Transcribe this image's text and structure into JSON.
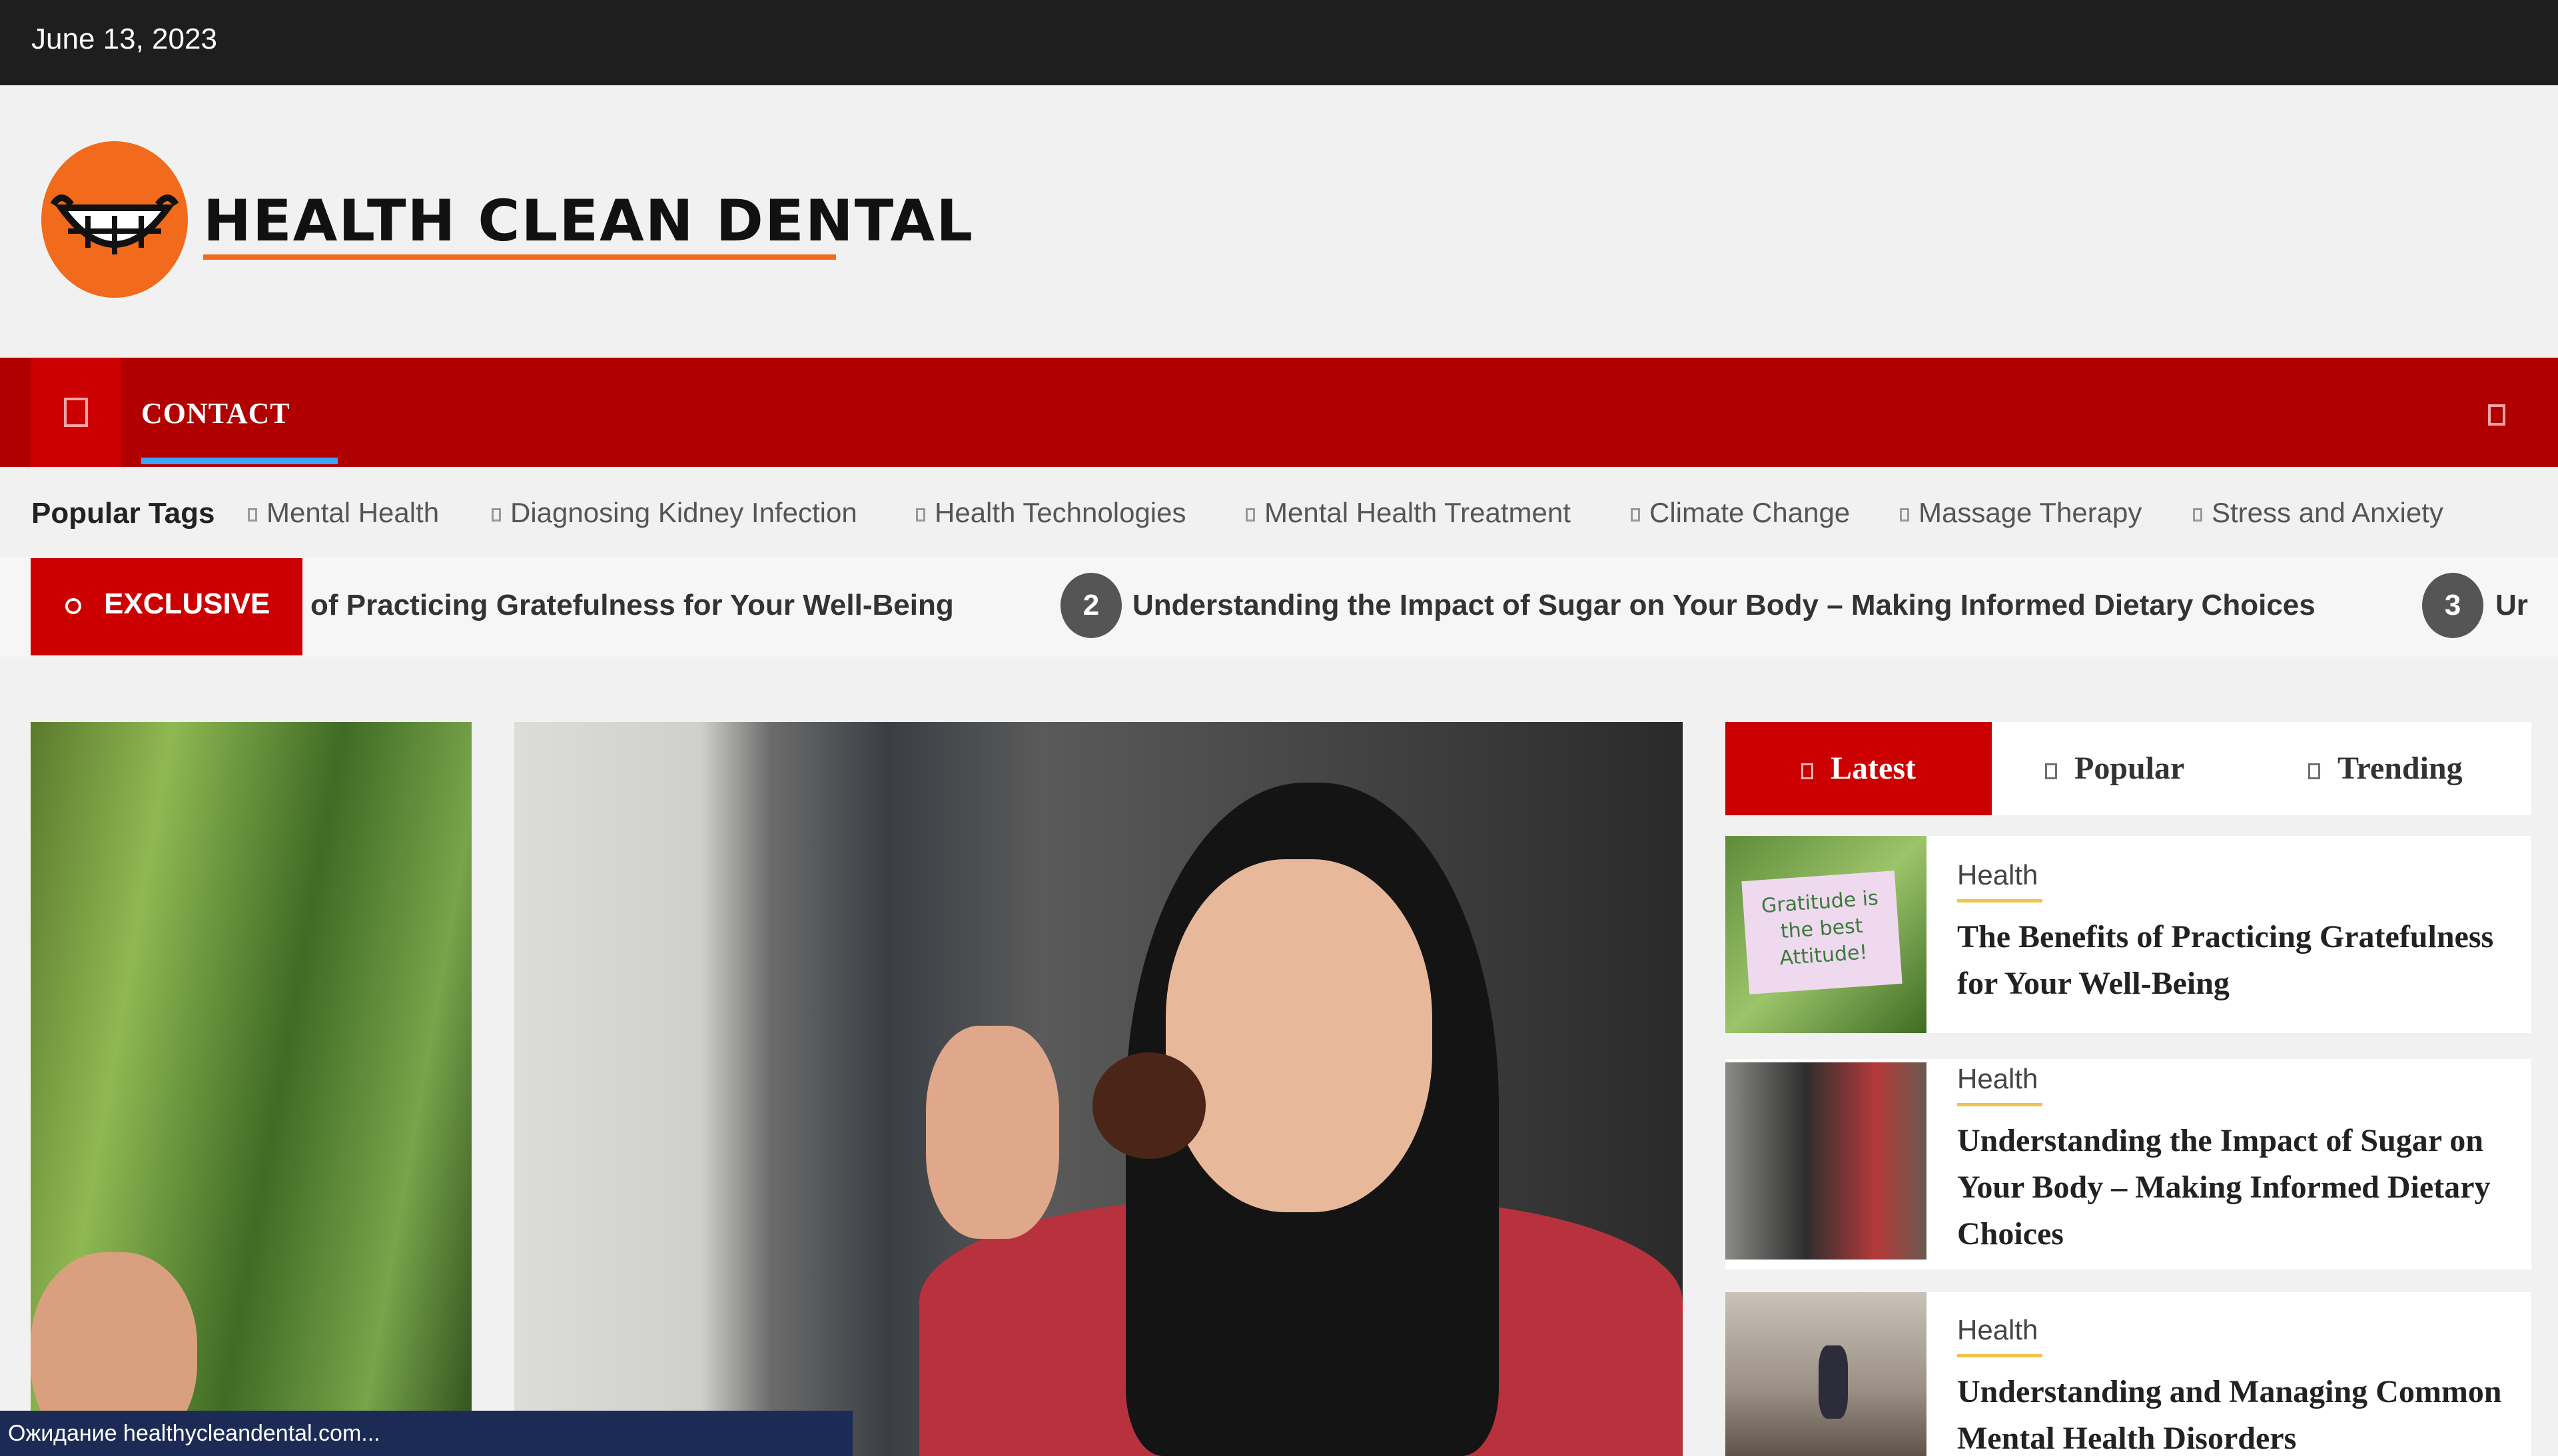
{
  "topbar": {
    "date": "June 13, 2023"
  },
  "header": {
    "logo_text": "HEALTH CLEAN DENTAL"
  },
  "nav": {
    "contact_label": "CONTACT"
  },
  "popular_tags": {
    "label": "Popular Tags",
    "items": [
      "Mental Health",
      "Diagnosing Kidney Infection",
      "Health Technologies",
      "Mental Health Treatment",
      "Climate Change",
      "Massage Therapy",
      "Stress and Anxiety"
    ]
  },
  "ticker": {
    "badge": "EXCLUSIVE",
    "items": [
      {
        "text": "of Practicing Gratefulness for Your Well-Being"
      },
      {
        "num": "2",
        "text": "Understanding the Impact of Sugar on Your Body – Making Informed Dietary Choices"
      },
      {
        "num": "3",
        "text": "Ur"
      }
    ]
  },
  "sidebar": {
    "tabs": [
      "Latest",
      "Popular",
      "Trending"
    ],
    "posts": [
      {
        "category": "Health",
        "title": "The Benefits of Practicing Gratefulness for Your Well-Being",
        "thumb_text": "Gratitude is the best Attitude!"
      },
      {
        "category": "Health",
        "title": "Understanding the Impact of Sugar on Your Body – Making Informed Dietary Choices"
      },
      {
        "category": "Health",
        "title": "Understanding and Managing Common Mental Health Disorders"
      }
    ]
  },
  "status_bar": {
    "text": "Ожидание healthycleandental.com..."
  },
  "colors": {
    "brand_red": "#cc0000",
    "nav_red": "#b10000",
    "logo_orange": "#f26a1b",
    "topbar": "#1e1e1e"
  }
}
